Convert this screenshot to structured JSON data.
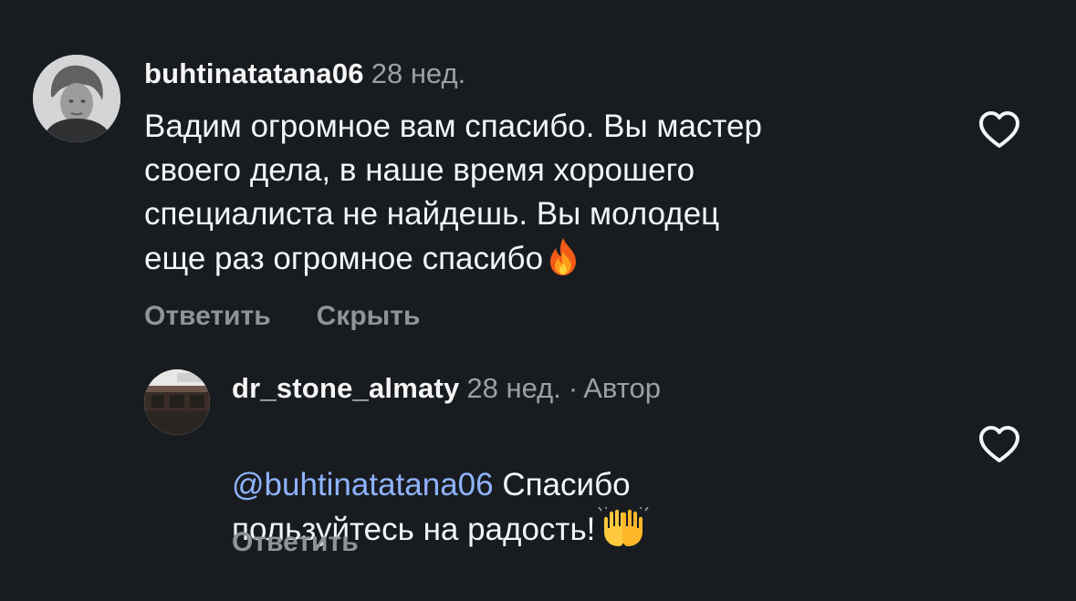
{
  "comments": [
    {
      "username": "buhtinatatana06",
      "time": "28 нед.",
      "text": "Вадим огромное вам спасибо. Вы мастер\nсвоего дела, в наше время хорошего\nспециалиста не найдешь. Вы молодец\nеще раз огромное спасибо",
      "emoji": "fire",
      "actions": {
        "reply": "Ответить",
        "hide": "Скрыть"
      }
    }
  ],
  "reply": {
    "username": "dr_stone_almaty",
    "time": "28 нед.",
    "separator": "·",
    "author_badge": "Автор",
    "mention": "@buhtinatatana06",
    "text_line1": " Спасибо",
    "text_line2": "пользуйтесь на радость!",
    "emoji": "raising-hands",
    "actions": {
      "reply": "Ответить"
    }
  },
  "theme": {
    "background": "#181c20",
    "text": "#f3f5f7",
    "muted": "#9aa0a6",
    "mention": "#8fb3ff"
  }
}
